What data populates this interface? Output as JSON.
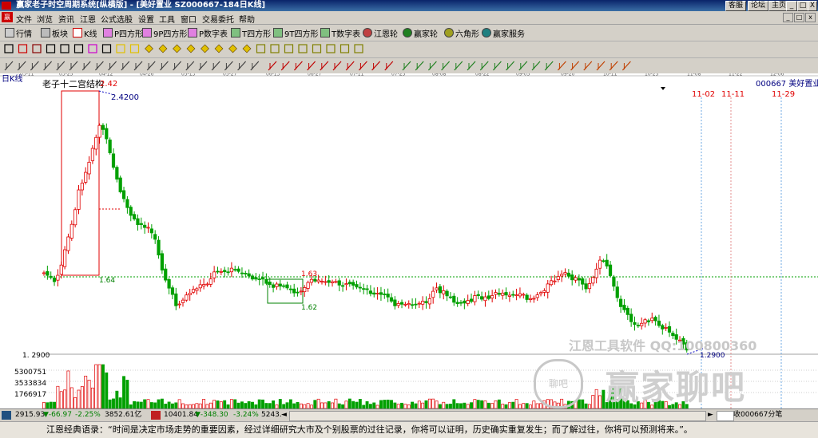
{
  "window": {
    "title": "赢家老子时空周期系统[纵横版] - [美好置业   SZ000667-184日K线]",
    "buttons": [
      "客服",
      "论坛",
      "主页"
    ],
    "controls": [
      "_",
      "□",
      "X"
    ]
  },
  "menu": {
    "items": [
      "文件",
      "浏览",
      "资讯",
      "江恩",
      "公式选股",
      "设置",
      "工具",
      "窗口",
      "交易委托",
      "帮助"
    ],
    "window_controls": [
      "_",
      "□",
      "x"
    ]
  },
  "toolbar1": {
    "items": [
      "行情",
      "板块",
      "K线",
      "P四方形",
      "9P四方形",
      "P数字表",
      "T四方形",
      "9T四方形",
      "T数字表",
      "江恩轮",
      "赢家轮",
      "六角形",
      "赢家服务"
    ]
  },
  "chart": {
    "label": "日K线",
    "title": "老子十二宫结构",
    "stock": "000667 美好置业",
    "date_ticks": [
      "03-11",
      "03-25",
      "04-12",
      "04-26",
      "05-13",
      "05-27",
      "06-13",
      "06-27",
      "07-11",
      "07-25",
      "08-08",
      "08-22",
      "09-05",
      "09-20",
      "10-11",
      "10-25",
      "11-08",
      "11-22",
      "12-06"
    ],
    "price_labels": {
      "top_peak": "2.42",
      "top_line": "2.4200",
      "box_low": "1.64",
      "mid_high": "1.63",
      "mid_low": "1.62",
      "low": "1.2900",
      "axis_low": "1. 2900"
    },
    "future_dates": [
      "11-02",
      "11-11",
      "11-29"
    ],
    "volume_labels": [
      "5300751",
      "3533834",
      "1766917"
    ],
    "colors": {
      "up": "#e00000",
      "down": "#00a000",
      "bg": "#ffffff",
      "dashed_green": "#00a000"
    }
  },
  "watermark": {
    "line1": "江恩工具软件  QQ:100800360",
    "logo": "赢家聊吧",
    "logo_circle": "聊吧"
  },
  "status": {
    "sh_index": "2915.93",
    "sh_change": "▼-66.97",
    "sh_pct": "-2.25%",
    "sh_amount": "3852.61亿",
    "sz_index": "10401.84",
    "sz_change": "▼-348.30",
    "sz_pct": "-3.24%",
    "sz_amount": "5243.",
    "right_text": "收000667分笔"
  },
  "quote": {
    "text": "江恩经典语录：“时间是决定市场走势的重要因素，经过详细研究大市及个别股票的过往记录，你将可以证明，历史确实重复发生；而了解过往，你将可以预测将来。”。"
  }
}
